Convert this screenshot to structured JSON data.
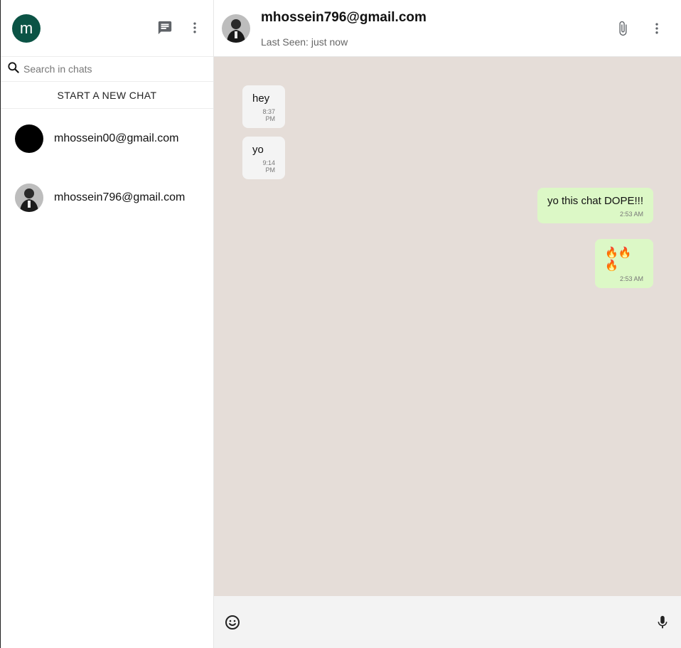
{
  "user": {
    "avatar_letter": "m",
    "avatar_color": "#0b5345"
  },
  "sidebar": {
    "search_placeholder": "Search in chats",
    "new_chat_label": "START A NEW CHAT",
    "chats": [
      {
        "name": "mhossein00@gmail.com",
        "avatar": "black-circle"
      },
      {
        "name": "mhossein796@gmail.com",
        "avatar": "photo"
      }
    ]
  },
  "conversation": {
    "name": "mhossein796@gmail.com",
    "last_seen": "Last Seen: just now",
    "messages": [
      {
        "text": "hey",
        "time": "8:37 PM",
        "direction": "incoming"
      },
      {
        "text": "yo",
        "time": "9:14 PM",
        "direction": "incoming"
      },
      {
        "text": "yo this chat DOPE!!!",
        "time": "2:53 AM",
        "direction": "outgoing"
      },
      {
        "text": "🔥🔥🔥",
        "time": "2:53 AM",
        "direction": "outgoing"
      }
    ]
  },
  "colors": {
    "incoming_bubble": "#f4f4f4",
    "outgoing_bubble": "#dcf8c6",
    "chat_background": "#e5ddd8"
  },
  "icons": [
    "chat-icon",
    "more-vert-icon",
    "search-icon",
    "attach-icon",
    "emoji-icon",
    "mic-icon"
  ]
}
